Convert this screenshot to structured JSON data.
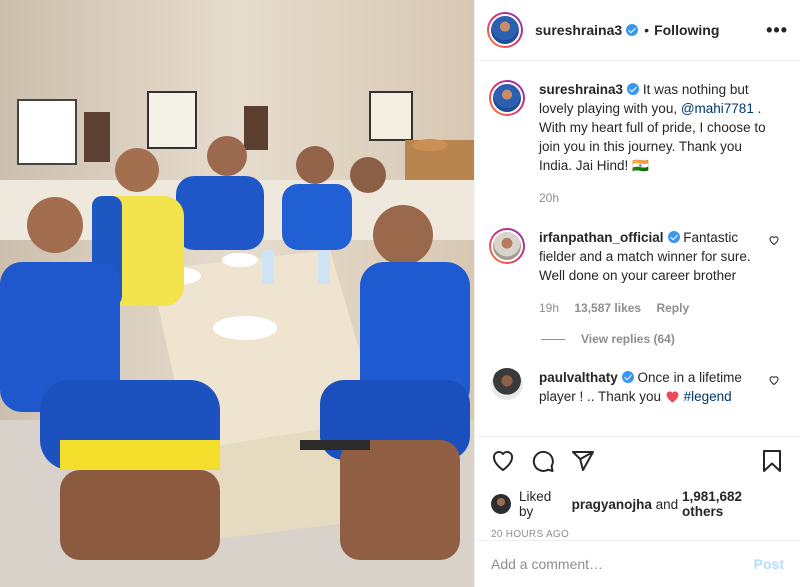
{
  "post": {
    "author": "sureshraina3",
    "follow_status": "Following",
    "more_label": "•••",
    "caption": {
      "username": "sureshraina3",
      "text_before": "It was nothing but lovely playing with you, ",
      "mention": "@mahi7781",
      "text_after": " . With my heart full of pride, I choose to join you in this journey. Thank you India. Jai Hind! 🇮🇳",
      "time": "20h"
    },
    "comments": [
      {
        "username": "irfanpathan_official",
        "text": "Fantastic fielder and a match winner for sure. Well done on your career brother",
        "time": "19h",
        "likes": "13,587 likes",
        "reply_label": "Reply",
        "view_replies": "View replies (64)"
      },
      {
        "username": "paulvalthaty",
        "text": "Once in a lifetime player ! .. Thank you ",
        "hashtag": "#legend"
      }
    ],
    "liked_by": {
      "prefix": "Liked by ",
      "user": "pragyanojha",
      "middle": " and ",
      "count": "1,981,682 others"
    },
    "timestamp": "20 HOURS AGO",
    "add_comment_placeholder": "Add a comment…",
    "post_button": "Post",
    "colors": {
      "link": "#00376b",
      "verified": "#3897f0",
      "post_disabled": "#b2dffc",
      "heart": "#ed4956"
    },
    "icons": [
      "heart-icon",
      "comment-icon",
      "share-icon",
      "bookmark-icon",
      "verified-icon",
      "more-icon"
    ]
  }
}
